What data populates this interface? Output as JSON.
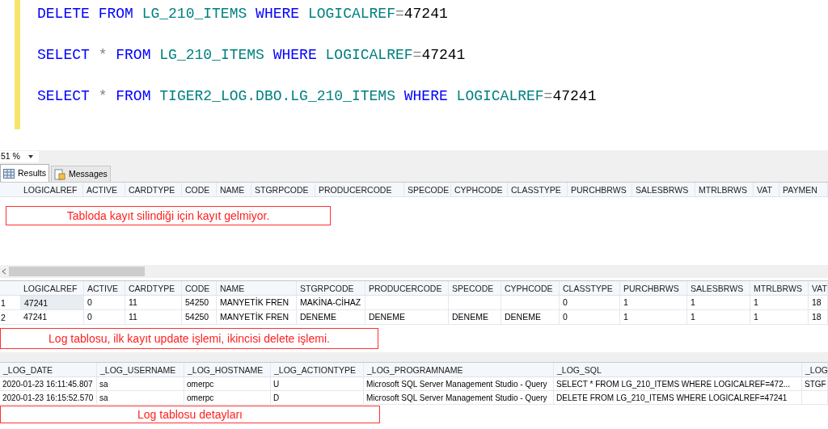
{
  "editor": {
    "lines": [
      {
        "tokens": [
          {
            "kind": "keyword",
            "text": "DELETE"
          },
          {
            "kind": "keyword",
            "text": "FROM"
          },
          {
            "kind": "ident",
            "text": "LG_210_ITEMS"
          },
          {
            "kind": "keyword",
            "text": "WHERE"
          },
          {
            "kind": "ident",
            "text": "LOGICALREF"
          },
          {
            "kind": "op",
            "text": "=",
            "join": true
          },
          {
            "kind": "number",
            "text": "47241",
            "join": true
          }
        ]
      },
      {
        "tokens": [
          {
            "kind": "keyword",
            "text": "SELECT"
          },
          {
            "kind": "op",
            "text": "*"
          },
          {
            "kind": "keyword",
            "text": "FROM"
          },
          {
            "kind": "ident",
            "text": "LG_210_ITEMS"
          },
          {
            "kind": "keyword",
            "text": "WHERE"
          },
          {
            "kind": "ident",
            "text": "LOGICALREF"
          },
          {
            "kind": "op",
            "text": "=",
            "join": true
          },
          {
            "kind": "number",
            "text": "47241",
            "join": true
          }
        ]
      },
      {
        "tokens": [
          {
            "kind": "keyword",
            "text": "SELECT"
          },
          {
            "kind": "op",
            "text": "*"
          },
          {
            "kind": "keyword",
            "text": "FROM"
          },
          {
            "kind": "ident",
            "text": "TIGER2_LOG.DBO.LG_210_ITEMS"
          },
          {
            "kind": "keyword",
            "text": "WHERE"
          },
          {
            "kind": "ident",
            "text": "LOGICALREF"
          },
          {
            "kind": "op",
            "text": "=",
            "join": true
          },
          {
            "kind": "number",
            "text": "47241",
            "join": true
          }
        ]
      }
    ]
  },
  "zoom": {
    "value": "51 %"
  },
  "tabs": [
    {
      "label": "Results",
      "selected": true
    },
    {
      "label": "Messages",
      "selected": false
    }
  ],
  "grid_1": {
    "columns": [
      "LOGICALREF",
      "ACTIVE",
      "CARDTYPE",
      "CODE",
      "NAME",
      "STGRPCODE",
      "PRODUCERCODE",
      "SPECODE",
      "CYPHCODE",
      "CLASSTYPE",
      "PURCHBRWS",
      "SALESBRWS",
      "MTRLBRWS",
      "VAT",
      "PAYMEN"
    ]
  },
  "note_1": "Tabloda kayıt silindiği için kayıt gelmiyor.",
  "grid_2": {
    "columns": [
      "LOGICALREF",
      "ACTIVE",
      "CARDTYPE",
      "CODE",
      "NAME",
      "STGRPCODE",
      "PRODUCERCODE",
      "SPECODE",
      "CYPHCODE",
      "CLASSTYPE",
      "PURCHBRWS",
      "SALESBRWS",
      "MTRLBRWS",
      "VAT"
    ],
    "rows": [
      {
        "number": "1",
        "cells": [
          {
            "text": "47241",
            "focused": true
          },
          {
            "text": "0",
            "focused": false
          },
          {
            "text": "11",
            "focused": false
          },
          {
            "text": "54250",
            "focused": false
          },
          {
            "text": "MANYETİK FREN",
            "focused": false
          },
          {
            "text": "MAKİNA-CİHAZ",
            "focused": false
          },
          {
            "focused": false
          },
          {
            "focused": false
          },
          {
            "focused": false
          },
          {
            "text": "0",
            "focused": false
          },
          {
            "text": "1",
            "focused": false
          },
          {
            "text": "1",
            "focused": false
          },
          {
            "text": "1",
            "focused": false
          },
          {
            "text": "18",
            "focused": false
          }
        ]
      },
      {
        "number": "2",
        "cells": [
          {
            "text": "47241",
            "focused": false
          },
          {
            "text": "0",
            "focused": false
          },
          {
            "text": "11",
            "focused": false
          },
          {
            "text": "54250",
            "focused": false
          },
          {
            "text": "MANYETİK FREN",
            "focused": false
          },
          {
            "text": "DENEME",
            "focused": false
          },
          {
            "text": "DENEME",
            "focused": false
          },
          {
            "text": "DENEME",
            "focused": false
          },
          {
            "text": "DENEME",
            "focused": false
          },
          {
            "text": "0",
            "focused": false
          },
          {
            "text": "1",
            "focused": false
          },
          {
            "text": "1",
            "focused": false
          },
          {
            "text": "1",
            "focused": false
          },
          {
            "text": "18",
            "focused": false
          }
        ]
      }
    ]
  },
  "note_2": "Log tablosu, ilk kayıt update işlemi, ikincisi delete işlemi.",
  "grid_3": {
    "columns": [
      "_LOG_DATE",
      "_LOG_USERNAME",
      "_LOG_HOSTNAME",
      "_LOG_ACTIONTYPE",
      "_LOG_PROGRAMNAME",
      "_LOG_SQL",
      "_LOG"
    ],
    "rows": [
      [
        "2020-01-23 16:11:45.807",
        "sa",
        "omerpc",
        "U",
        "Microsoft SQL Server Management Studio - Query",
        "SELECT * FROM LG_210_ITEMS WHERE LOGICALREF=472...",
        "STGF"
      ],
      [
        "2020-01-23 16:15:52.570",
        "sa",
        "omerpc",
        "D",
        "Microsoft SQL Server Management Studio - Query",
        "DELETE FROM LG_210_ITEMS WHERE LOGICALREF=47241",
        ""
      ]
    ]
  },
  "note_3": "Log tablosu detayları"
}
